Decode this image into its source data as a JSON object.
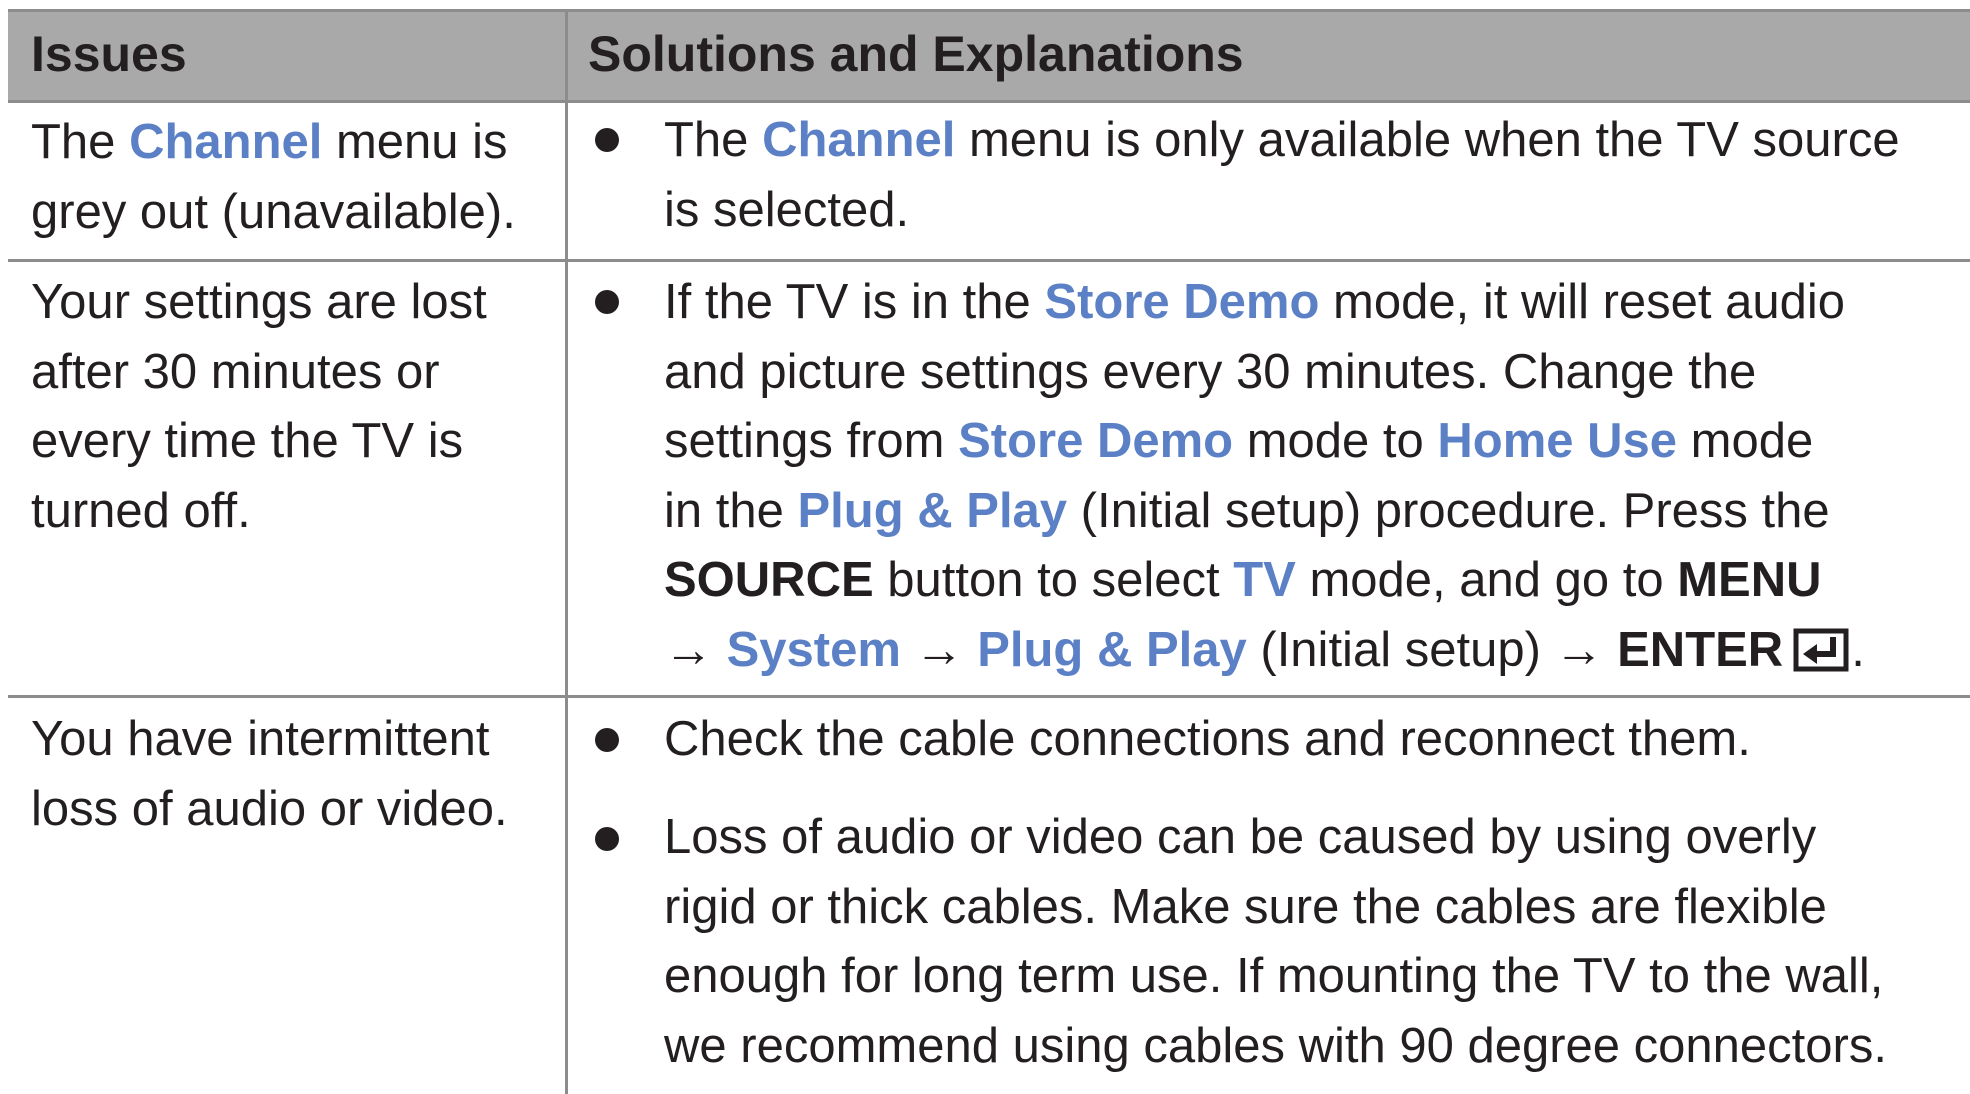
{
  "table": {
    "headers": {
      "issues": "Issues",
      "solutions": "Solutions and Explanations"
    },
    "rows": [
      {
        "issue_lines": [
          [
            "The ",
            "Channel",
            " menu is"
          ],
          [
            "grey out (unavailable)."
          ]
        ],
        "solutions": [
          {
            "lines": [
              [
                "The ",
                "Channel",
                " menu is only available when the TV source"
              ],
              [
                "is selected."
              ]
            ]
          }
        ]
      },
      {
        "issue_lines": [
          "Your settings are lost",
          "after 30 minutes or",
          "every time the TV is",
          "turned off."
        ],
        "solutions": [
          {
            "lines": [
              [
                "If the TV is in the ",
                "Store Demo",
                " mode, it will reset audio"
              ],
              [
                "and picture settings every 30 minutes. Change the"
              ],
              [
                "settings from ",
                "Store Demo",
                " mode to ",
                "Home Use",
                " mode"
              ],
              [
                "in the ",
                "Plug & Play",
                " (Initial setup) procedure. Press the"
              ],
              [
                "SOURCE",
                " button to select ",
                "TV",
                " mode, and go to ",
                "MENU"
              ],
              [
                "→ ",
                "System",
                " → ",
                "Plug & Play",
                " (Initial setup) → ",
                "ENTER",
                "."
              ]
            ]
          }
        ]
      },
      {
        "issue_lines": [
          "You have intermittent",
          "loss of audio or video."
        ],
        "solutions": [
          {
            "lines": [
              [
                "Check the cable connections and reconnect them."
              ]
            ]
          },
          {
            "lines": [
              [
                "Loss of audio or video can be caused by using overly"
              ],
              [
                "rigid or thick cables. Make sure the cables are flexible"
              ],
              [
                "enough for long term use. If mounting the TV to the wall,"
              ],
              [
                "we recommend using cables with 90 degree connectors."
              ]
            ]
          }
        ]
      }
    ]
  },
  "icons": {
    "enter": "enter-key-icon"
  },
  "colors": {
    "highlight": "#5b80c5",
    "header_bg": "#a9a9a9",
    "rule": "#8c8c8c",
    "text": "#231f20"
  }
}
